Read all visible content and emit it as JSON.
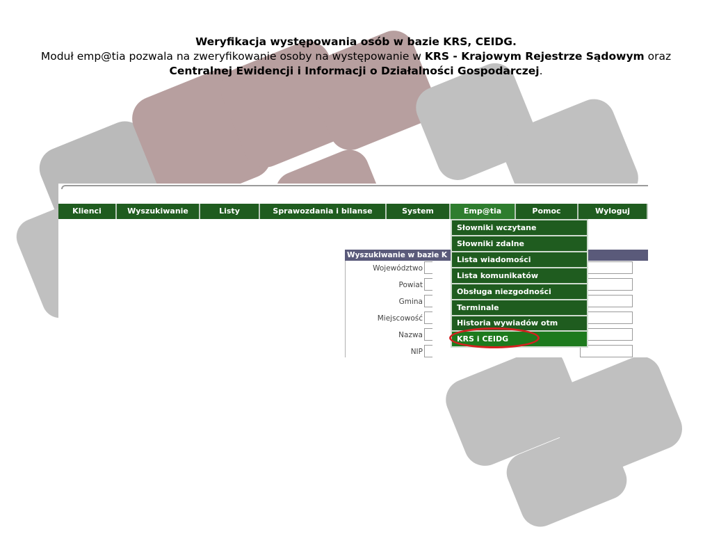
{
  "caption": {
    "title": "Weryfikacja występowania osób w bazie KRS, CEIDG.",
    "line_plain_1": "Moduł emp@tia pozwala na zweryfikowanie osoby na występowanie w ",
    "line_bold_1": "KRS - Krajowym Rejestrze Sądowym",
    "line_plain_2": " oraz ",
    "line_bold_2": "Centralnej Ewidencji i Informacji o Działalności Gospodarczej",
    "line_end": "."
  },
  "menu": {
    "items": [
      {
        "label": "Klienci"
      },
      {
        "label": "Wyszukiwanie"
      },
      {
        "label": "Listy"
      },
      {
        "label": "Sprawozdania i bilanse"
      },
      {
        "label": "System"
      },
      {
        "label": "Emp@tia"
      },
      {
        "label": "Pomoc"
      },
      {
        "label": "Wyloguj"
      }
    ],
    "active": "Emp@tia"
  },
  "dropdown": {
    "items": [
      {
        "label": "Słowniki wczytane"
      },
      {
        "label": "Słowniki zdalne"
      },
      {
        "label": "Lista wiadomości"
      },
      {
        "label": "Lista komunikatów"
      },
      {
        "label": "Obsługa niezgodności"
      },
      {
        "label": "Terminale"
      },
      {
        "label": "Historia wywiadów otm"
      },
      {
        "label": "KRS i CEIDG"
      }
    ]
  },
  "form": {
    "header": "Wyszukiwanie w bazie K",
    "fields": [
      {
        "label": "Województwo"
      },
      {
        "label": "Powiat"
      },
      {
        "label": "Gmina"
      },
      {
        "label": "Miejscowość"
      },
      {
        "label": "Nazwa"
      },
      {
        "label": "NIP"
      }
    ]
  },
  "colors": {
    "menu_green": "#1f5c1f",
    "highlight_red": "#d42020",
    "tile_brown": "#b49a9a",
    "tile_gray": "#bdbdbd"
  }
}
